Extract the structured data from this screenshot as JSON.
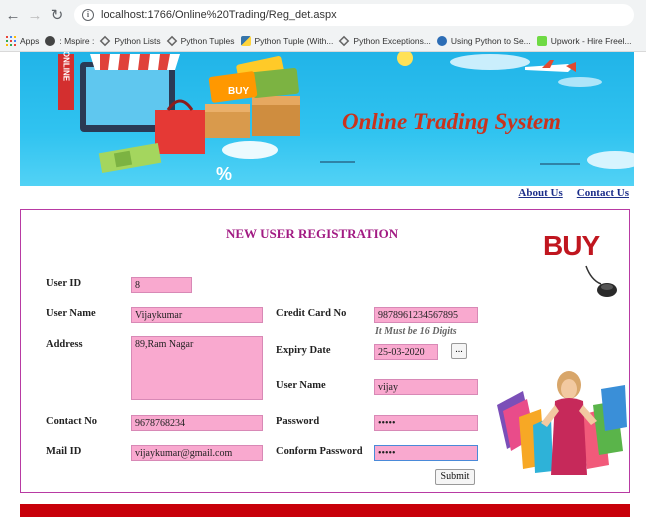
{
  "browser": {
    "url": "localhost:1766/Online%20Trading/Reg_det.aspx",
    "bookmarks": [
      "Apps",
      ": Mspire :",
      "Python Lists",
      "Python Tuples",
      "Python Tuple (With...",
      "Python Exceptions...",
      "Using Python to Se...",
      "Upwork - Hire Freel..."
    ]
  },
  "banner": {
    "title": "Online Trading System",
    "sign_text": "ONLINE",
    "bag_text": "BUY"
  },
  "top_links": {
    "about": "About Us",
    "contact": "Contact Us"
  },
  "form": {
    "heading": "NEW USER REGISTRATION",
    "buy_logo": "BUY",
    "labels": {
      "user_id": "User ID",
      "user_name": "User Name",
      "address": "Address",
      "contact_no": "Contact No",
      "mail_id": "Mail ID",
      "credit_card": "Credit Card No",
      "expiry_date": "Expiry Date",
      "user_name2": "User Name",
      "password": "Password",
      "confirm_password": "Conform Password"
    },
    "values": {
      "user_id": "8",
      "user_name": "Vijaykumar",
      "address": "89,Ram Nagar",
      "contact_no": "9678768234",
      "mail_id": "vijaykumar@gmail.com",
      "credit_card": "9878961234567895",
      "expiry_date": "25-03-2020",
      "user_name2": "vijay",
      "password": "•••••",
      "confirm_password": "•••••"
    },
    "credit_hint": "It Must be 16 Digits",
    "date_picker_label": "...",
    "submit_label": "Submit"
  },
  "colors": {
    "input_bg": "#f9a9cf",
    "heading": "#a21b83",
    "panel_border": "#b83aa3",
    "banner_title": "#c9331d",
    "footer_bar": "#c8000a"
  }
}
